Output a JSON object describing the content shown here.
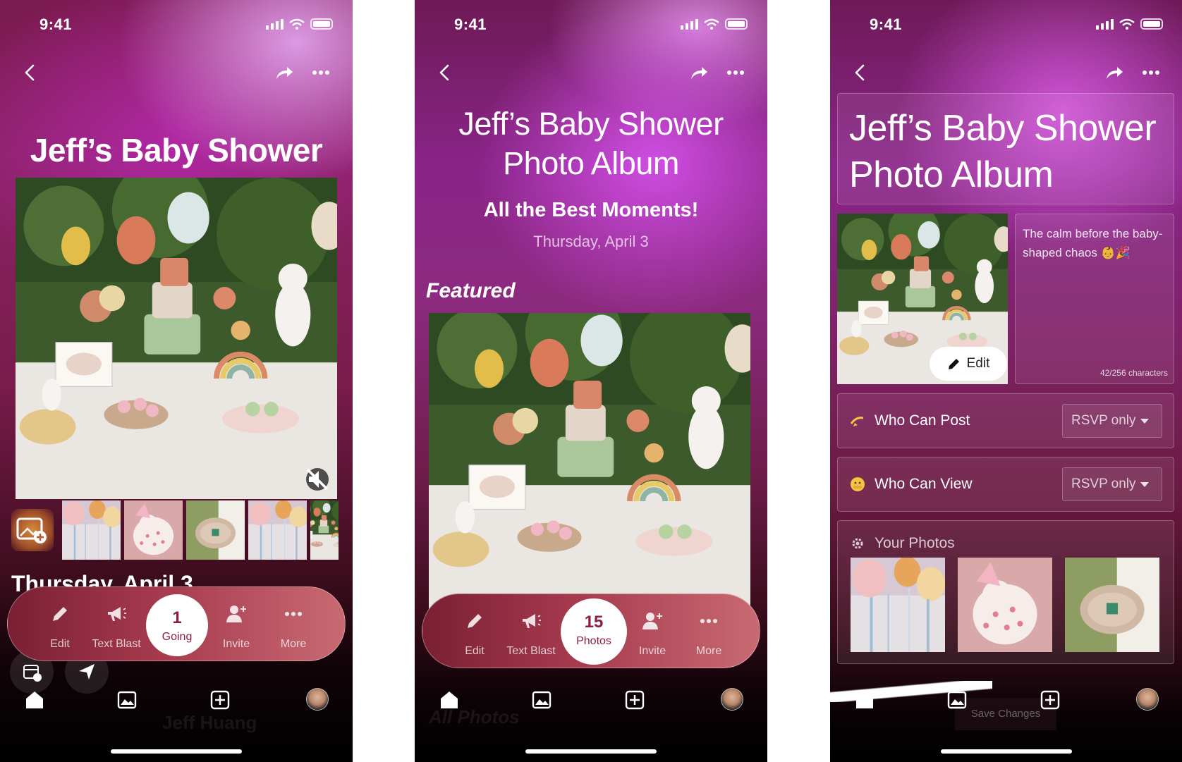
{
  "status": {
    "time": "9:41"
  },
  "screen1": {
    "title": "Jeff’s Baby Shower",
    "date_peek": "Thursday, April 3",
    "actions": [
      {
        "label": "Edit",
        "icon": "pencil-icon"
      },
      {
        "label": "Text Blast",
        "icon": "megaphone-icon"
      },
      {
        "label": "Invite",
        "icon": "add-person-icon"
      },
      {
        "label": "More",
        "icon": "ellipsis-icon"
      }
    ],
    "center": {
      "count": "1",
      "label": "Going"
    },
    "ghost_host": "Jeff Huang"
  },
  "screen2": {
    "title_line1": "Jeff’s Baby Shower",
    "title_line2": "Photo Album",
    "subtitle": "All the Best Moments!",
    "date": "Thursday, April 3",
    "featured_label": "Featured",
    "actions": [
      {
        "label": "Edit",
        "icon": "pencil-icon"
      },
      {
        "label": "Text Blast",
        "icon": "megaphone-icon"
      },
      {
        "label": "Invite",
        "icon": "add-person-icon"
      },
      {
        "label": "More",
        "icon": "ellipsis-icon"
      }
    ],
    "center": {
      "count": "15",
      "label": "Photos"
    },
    "ghost_section": "All Photos"
  },
  "screen3": {
    "title_line1": "Jeff’s Baby Shower",
    "title_line2": "Photo Album",
    "caption": "The calm before the baby-shaped chaos 👶🎉",
    "char_count": "42/256 characters",
    "edit_label": "Edit",
    "who_can_post": {
      "label": "Who Can Post",
      "value": "RSVP only"
    },
    "who_can_view": {
      "label": "Who Can View",
      "value": "RSVP only"
    },
    "your_photos": "Your Photos",
    "save_changes": "Save Changes"
  },
  "colors": {
    "accent_dark": "#7a1f34",
    "accent_light": "#c86a72",
    "center_text": "#8a1f3d"
  }
}
